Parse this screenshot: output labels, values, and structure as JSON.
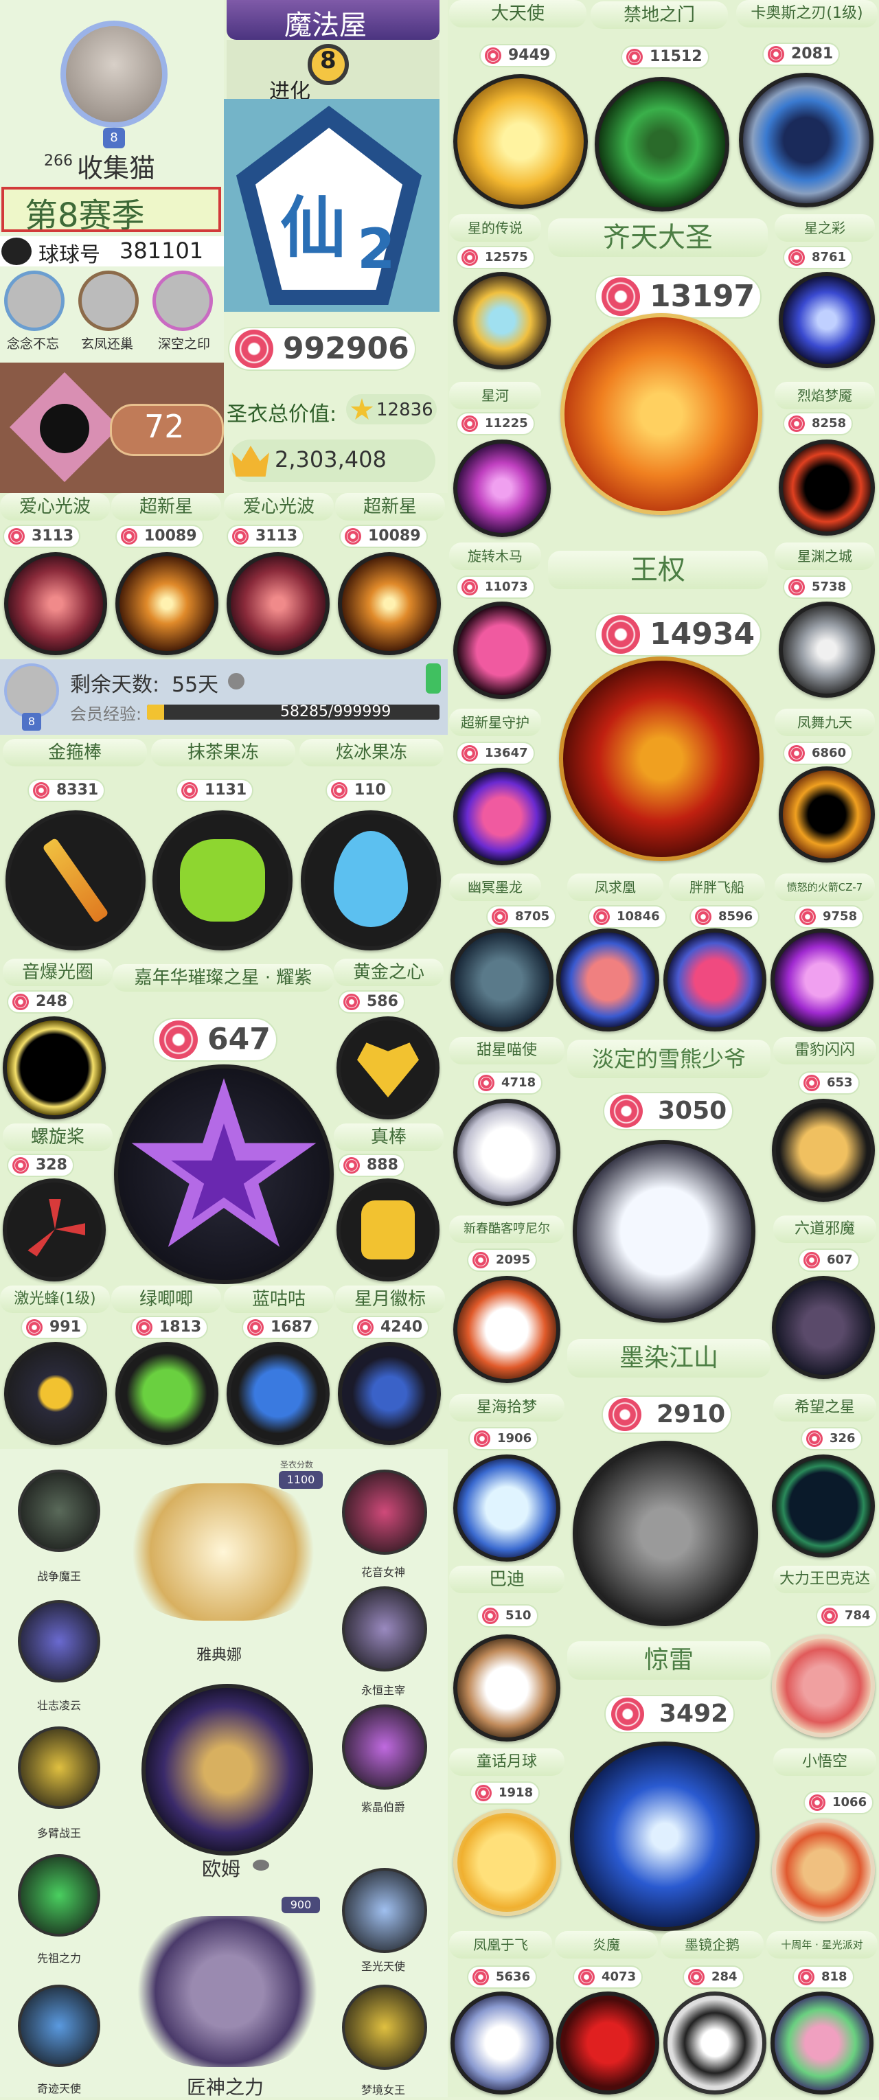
{
  "profile": {
    "level_badge": "8",
    "likes_count": "266",
    "username": "收集猫",
    "season": "第8赛季",
    "ball_id_label": "球球号",
    "ball_id_value": "381101",
    "friends": [
      "念念不忘",
      "玄凤还巢",
      "深空之印"
    ],
    "pet_level": "72"
  },
  "top_banner": {
    "title": "魔法屋",
    "level": "8",
    "sub": "进化"
  },
  "rank": {
    "tier_char": "仙",
    "tier_num": "2"
  },
  "totals": {
    "candy": "992906",
    "suit_value_label": "圣衣总价值:",
    "suit_value": "12836",
    "crown_value": "2,303,408"
  },
  "row_spores": [
    {
      "name": "爱心光波",
      "count": "3113"
    },
    {
      "name": "超新星",
      "count": "10089"
    },
    {
      "name": "爱心光波",
      "count": "3113"
    },
    {
      "name": "超新星",
      "count": "10089"
    }
  ],
  "membership": {
    "remaining_label": "剩余天数:",
    "remaining_days": "55天",
    "exp_label": "会员经验:",
    "exp_value": "58285/999999",
    "exp_fraction": 0.058,
    "level_badge": "8"
  },
  "row_items": [
    {
      "name": "金箍棒",
      "count": "8331"
    },
    {
      "name": "抹茶果冻",
      "count": "1131"
    },
    {
      "name": "炫冰果冻",
      "count": "110"
    }
  ],
  "star_section": {
    "left_top": {
      "name": "音爆光圈",
      "count": "248"
    },
    "title": "嘉年华璀璨之星 · 耀紫",
    "count": "647",
    "right_top": {
      "name": "黄金之心",
      "count": "586"
    },
    "left_bottom": {
      "name": "螺旋桨",
      "count": "328"
    },
    "right_bottom": {
      "name": "真棒",
      "count": "888"
    }
  },
  "row_pets": [
    {
      "name": "激光蜂(1级)",
      "count": "991"
    },
    {
      "name": "绿唧唧",
      "count": "1813"
    },
    {
      "name": "蓝咕咕",
      "count": "1687"
    },
    {
      "name": "星月徽标",
      "count": "4240"
    }
  ],
  "suits": {
    "score_label": "圣衣分数",
    "big_score": "1100",
    "score_900": "900",
    "names": [
      "战争魔王",
      "雅典娜",
      "花音女神",
      "壮志凌云",
      "永恒主宰",
      "多臂战王",
      "紫晶伯爵",
      "欧姆",
      "先祖之力",
      "圣光天使",
      "奇迹天使",
      "匠神之力",
      "梦境女王"
    ]
  },
  "right_col": {
    "top_row": [
      {
        "name": "大天使",
        "count": "9449"
      },
      {
        "name": "禁地之门",
        "count": "11512"
      },
      {
        "name": "卡奥斯之刃(1级)",
        "count": "2081"
      }
    ],
    "qitian": {
      "title": "齐天大圣",
      "count": "13197"
    },
    "left_1": {
      "name": "星的传说",
      "count": "12575"
    },
    "left_2": {
      "name": "星河",
      "count": "11225"
    },
    "left_3": {
      "name": "旋转木马",
      "count": "11073"
    },
    "left_4": {
      "name": "超新星守护",
      "count": "13647"
    },
    "left_5": {
      "name": "幽冥墨龙",
      "count": ""
    },
    "right_1": {
      "name": "星之彩",
      "count": "8761"
    },
    "right_2": {
      "name": "烈焰梦魇",
      "count": "8258"
    },
    "right_3": {
      "name": "星渊之城",
      "count": "5738"
    },
    "right_4": {
      "name": "凤舞九天",
      "count": "6860"
    },
    "right_5": {
      "name": "愤怒的火箭CZ-7",
      "count": ""
    },
    "wangquan": {
      "title": "王权",
      "count": "14934"
    },
    "mid_row": [
      {
        "name": "凤求凰",
        "count": "8705"
      },
      {
        "name": "胖胖飞船",
        "count": "10846"
      },
      {
        "name": "",
        "count": "8596"
      },
      {
        "name": "",
        "count": "9758"
      }
    ],
    "tianxing": {
      "name": "甜星喵使",
      "count": "4718"
    },
    "xiong": {
      "title": "淡定的雪熊少爷",
      "count": "3050"
    },
    "leibao": {
      "name": "雷豹闪闪",
      "count": "653"
    },
    "xinchun": {
      "name": "新春酷客哼尼尔",
      "count": "2095"
    },
    "liudao": {
      "name": "六道邪魔",
      "count": "607"
    },
    "moran": {
      "title": "墨染江山",
      "count": "2910"
    },
    "xinghai": {
      "name": "星海拾梦",
      "count": "1906"
    },
    "xiwang": {
      "name": "希望之星",
      "count": "326"
    },
    "badi": {
      "name": "巴迪",
      "count": "510"
    },
    "dali": {
      "name": "大力王巴克达",
      "count": "784"
    },
    "jinglei": {
      "title": "惊雷",
      "count": "3492"
    },
    "tongyue": {
      "name": "童话月球",
      "count": "1918"
    },
    "wukong": {
      "name": "小悟空",
      "count": "1066"
    },
    "bottom_labels": [
      "凤凰于飞",
      "炎魔",
      "墨镜企鹅",
      "十周年 · 星光派对"
    ],
    "bottom_counts": [
      "5636",
      "4073",
      "284",
      "818"
    ]
  }
}
